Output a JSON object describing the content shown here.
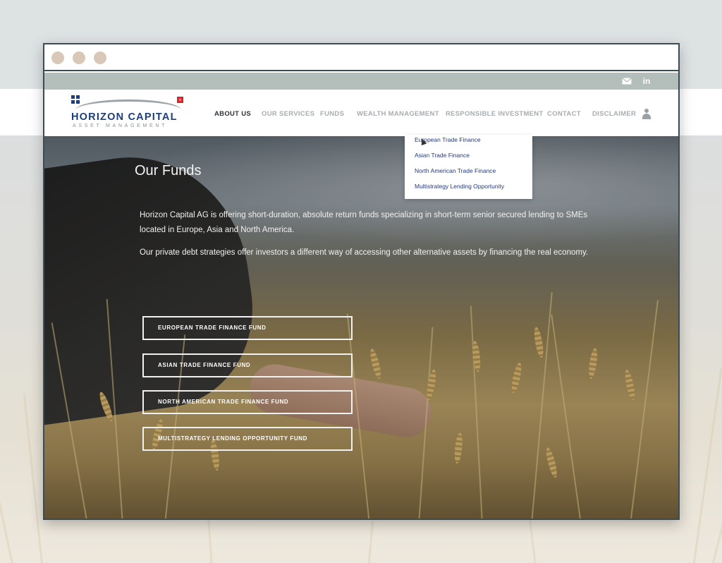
{
  "brand": {
    "name": "HORIZON CAPITAL",
    "tagline": "ASSET MANAGEMENT",
    "primary_color": "#1c3f7a",
    "flag_color": "#d6242b"
  },
  "topbar": {
    "icons": [
      "mail-icon",
      "linkedin-icon"
    ],
    "linkedin_label": "in"
  },
  "nav": {
    "items": [
      {
        "label": "ABOUT US",
        "active": true
      },
      {
        "label": "OUR SERVICES",
        "active": false
      },
      {
        "label": "FUNDS",
        "active": false
      },
      {
        "label": "WEALTH MANAGEMENT",
        "active": false
      },
      {
        "label": "RESPONSIBLE INVESTMENT",
        "active": false
      },
      {
        "label": "CONTACT",
        "active": false
      },
      {
        "label": "DISCLAIMER",
        "active": false
      }
    ],
    "user_icon": "user-icon"
  },
  "dropdown": {
    "items": [
      "European Trade Finance",
      "Asian Trade Finance",
      "North American Trade Finance",
      "Multistrategy Lending Opportunity"
    ]
  },
  "hero": {
    "title": "Our Funds",
    "paragraph_1": "Horizon Capital AG is offering short-duration, absolute return funds specializing in short-term senior secured lending to SMEs located in Europe, Asia and North America.",
    "paragraph_2": "Our private debt strategies offer investors a different way of accessing other alternative assets by financing the real economy.",
    "buttons": [
      "EUROPEAN TRADE FINANCE FUND",
      "ASIAN TRADE FINANCE FUND",
      "NORTH AMERICAN TRADE FINANCE FUND",
      "MULTISTRATEGY LENDING OPPORTUNITY FUND"
    ]
  }
}
